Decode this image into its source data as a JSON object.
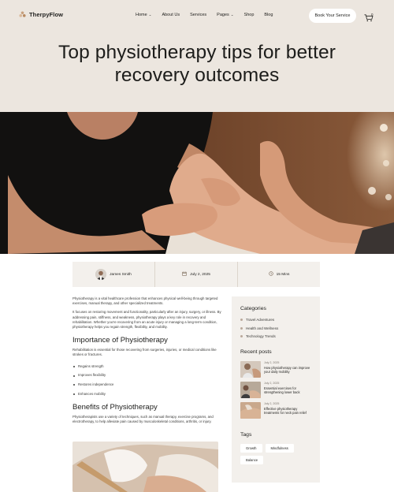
{
  "brand": {
    "name": "TherpyFlow",
    "accent": "#c7a07e"
  },
  "nav": {
    "items": [
      {
        "label": "Home",
        "dropdown": true
      },
      {
        "label": "About Us",
        "dropdown": false
      },
      {
        "label": "Services",
        "dropdown": false
      },
      {
        "label": "Pages",
        "dropdown": true
      },
      {
        "label": "Shop",
        "dropdown": false
      },
      {
        "label": "Blog",
        "dropdown": false
      }
    ],
    "cta": "Book Your Service",
    "cart_count": "0"
  },
  "hero": {
    "title": "Top physiotherapy tips for better recovery outcomes",
    "background": "#ece6df"
  },
  "meta": {
    "author": "James Smith",
    "date": "July 2, 2025",
    "read_time": "15 Mins"
  },
  "article": {
    "intro_1": "Physiotherapy is a vital healthcare profession that enhances physical well-being through targeted exercises, manual therapy, and other specialized treatments.",
    "intro_2": "It focuses on restoring movement and functionality, particularly after an injury, surgery, or illness. By addressing pain, stiffness, and weakness, physiotherapy plays a key role in recovery and rehabilitation. Whether you're recovering from an acute injury or managing a long-term condition, physiotherapy helps you regain strength, flexibility, and mobility.",
    "heading_1": "Importance of Physiotherapy",
    "para_1": "Rehabilitation is essential for those recovering from surgeries, injuries, or medical conditions like strokes or fractures.",
    "list": [
      "Regains strength",
      "Improves flexibility",
      "Restores independence",
      "Enhances mobility"
    ],
    "heading_2": "Benefits of Physiotherapy",
    "para_2": "Physiotherapists use a variety of techniques, such as manual therapy, exercise programs, and electrotherapy, to help alleviate pain caused by musculoskeletal conditions, arthritis, or injury."
  },
  "sidebar": {
    "categories_title": "Categories",
    "categories": [
      "Travel Adventures",
      "Health and Wellness",
      "Technology Trends"
    ],
    "recent_title": "Recent posts",
    "posts": [
      {
        "date": "July 2, 2025",
        "title": "How physiotherapy can improve your daily mobility"
      },
      {
        "date": "July 2, 2025",
        "title": "Essential exercises for strengthening lower back"
      },
      {
        "date": "July 2, 2025",
        "title": "Effective physiotherapy treatments for neck pain relief"
      }
    ],
    "tags_title": "Tags",
    "tags": [
      "Growth",
      "Mindfulness",
      "Balance"
    ]
  }
}
